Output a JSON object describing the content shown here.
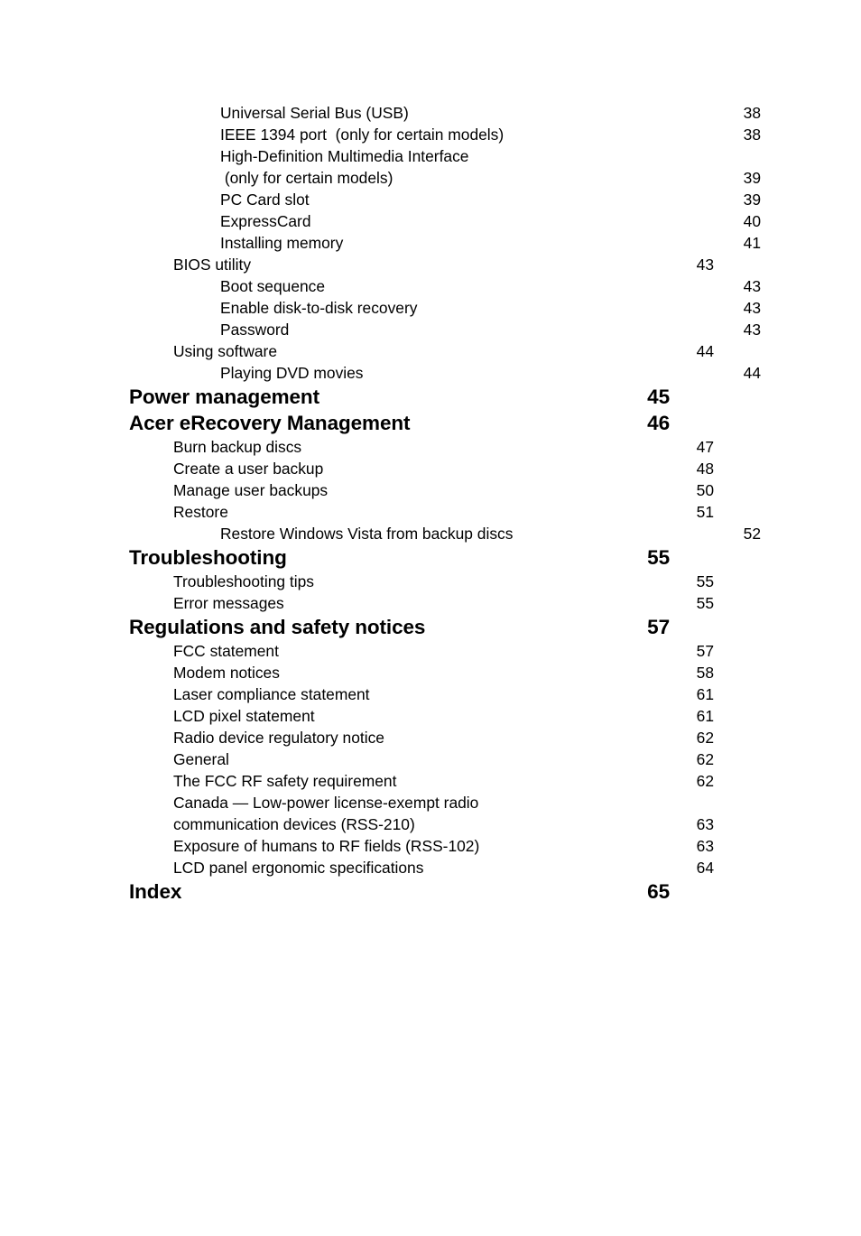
{
  "document": {
    "type": "table-of-contents",
    "text_color": "#000000",
    "background_color": "#ffffff"
  },
  "toc": {
    "entries": [
      {
        "label": "Universal Serial Bus (USB)",
        "page": "38",
        "level": 2
      },
      {
        "label": "IEEE 1394 port  (only for certain models)",
        "page": "38",
        "level": 2
      },
      {
        "label": "High-Definition Multimedia Interface",
        "page": "",
        "level": 2
      },
      {
        "label": " (only for certain models)",
        "page": "39",
        "level": 2
      },
      {
        "label": "PC Card slot",
        "page": "39",
        "level": 2
      },
      {
        "label": "ExpressCard",
        "page": "40",
        "level": 2
      },
      {
        "label": "Installing memory",
        "page": "41",
        "level": 2
      },
      {
        "label": "BIOS utility",
        "page": "43",
        "level": 1
      },
      {
        "label": "Boot sequence",
        "page": "43",
        "level": 2
      },
      {
        "label": "Enable disk-to-disk recovery",
        "page": "43",
        "level": 2
      },
      {
        "label": "Password",
        "page": "43",
        "level": 2
      },
      {
        "label": "Using software",
        "page": "44",
        "level": 1
      },
      {
        "label": "Playing DVD movies",
        "page": "44",
        "level": 2
      },
      {
        "label": "Power management",
        "page": "45",
        "level": 0
      },
      {
        "label": "Acer eRecovery Management",
        "page": "46",
        "level": 0
      },
      {
        "label": "Burn backup discs",
        "page": "47",
        "level": 1
      },
      {
        "label": "Create a user backup",
        "page": "48",
        "level": 1
      },
      {
        "label": "Manage user backups",
        "page": "50",
        "level": 1
      },
      {
        "label": "Restore",
        "page": "51",
        "level": 1
      },
      {
        "label": "Restore Windows Vista from backup discs",
        "page": "52",
        "level": 2
      },
      {
        "label": "Troubleshooting",
        "page": "55",
        "level": 0
      },
      {
        "label": "Troubleshooting tips",
        "page": "55",
        "level": 1
      },
      {
        "label": "Error messages",
        "page": "55",
        "level": 1
      },
      {
        "label": "Regulations and safety notices",
        "page": "57",
        "level": 0
      },
      {
        "label": "FCC statement",
        "page": "57",
        "level": 1
      },
      {
        "label": "Modem notices",
        "page": "58",
        "level": 1
      },
      {
        "label": "Laser compliance statement",
        "page": "61",
        "level": 1
      },
      {
        "label": "LCD pixel statement",
        "page": "61",
        "level": 1
      },
      {
        "label": "Radio device regulatory notice",
        "page": "62",
        "level": 1
      },
      {
        "label": "General",
        "page": "62",
        "level": 1
      },
      {
        "label": "The FCC RF safety requirement",
        "page": "62",
        "level": 1
      },
      {
        "label": "Canada — Low-power license-exempt radio",
        "page": "",
        "level": 1
      },
      {
        "label": "communication devices (RSS-210)",
        "page": "63",
        "level": 1
      },
      {
        "label": "Exposure of humans to RF fields (RSS-102)",
        "page": "63",
        "level": 1
      },
      {
        "label": "LCD panel ergonomic specifications",
        "page": "64",
        "level": 1
      },
      {
        "label": "Index",
        "page": "65",
        "level": 0
      }
    ]
  }
}
